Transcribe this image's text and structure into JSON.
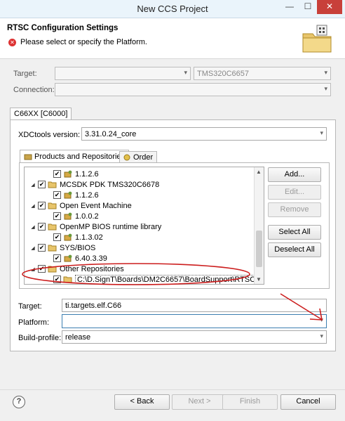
{
  "window": {
    "title": "New CCS Project",
    "min": "—",
    "max": "☐",
    "close": "✕"
  },
  "header": {
    "title": "RTSC Configuration Settings",
    "error": "Please select or specify the Platform."
  },
  "target_row": {
    "label": "Target:",
    "value": "",
    "device": "TMS320C6657"
  },
  "connection_row": {
    "label": "Connection:",
    "value": ""
  },
  "outer_tab": {
    "label": "C66XX [C6000]"
  },
  "xdctools": {
    "label": "XDCtools version:",
    "value": "3.31.0.24_core"
  },
  "inner_tabs": [
    {
      "label": "Products and Repositories"
    },
    {
      "label": "Order"
    }
  ],
  "tree": [
    {
      "indent": 1,
      "expander": "",
      "checked": true,
      "icon": "package",
      "label": "1.1.2.6"
    },
    {
      "indent": 0,
      "expander": "◢",
      "checked": true,
      "icon": "folder",
      "label": "MCSDK PDK TMS320C6678"
    },
    {
      "indent": 1,
      "expander": "",
      "checked": true,
      "icon": "package",
      "label": "1.1.2.6"
    },
    {
      "indent": 0,
      "expander": "◢",
      "checked": true,
      "icon": "folder",
      "label": "Open Event Machine"
    },
    {
      "indent": 1,
      "expander": "",
      "checked": true,
      "icon": "package",
      "label": "1.0.0.2"
    },
    {
      "indent": 0,
      "expander": "◢",
      "checked": true,
      "icon": "folder",
      "label": "OpenMP BIOS runtime library"
    },
    {
      "indent": 1,
      "expander": "",
      "checked": true,
      "icon": "package",
      "label": "1.1.3.02"
    },
    {
      "indent": 0,
      "expander": "◢",
      "checked": true,
      "icon": "folder",
      "label": "SYS/BIOS"
    },
    {
      "indent": 1,
      "expander": "",
      "checked": true,
      "icon": "package",
      "label": "6.40.3.39"
    },
    {
      "indent": 0,
      "expander": "◢",
      "checked": true,
      "icon": "folder",
      "label": "Other Repositories"
    },
    {
      "indent": 1,
      "expander": "",
      "checked": true,
      "icon": "folder",
      "label": "C:\\D.SignT\\Boards\\DM2C6657\\BoardSupport\\RTSC"
    }
  ],
  "side_buttons": {
    "add": "Add...",
    "edit": "Edit...",
    "remove": "Remove",
    "select_all": "Select All",
    "deselect_all": "Deselect All"
  },
  "bottom_fields": {
    "target": {
      "label": "Target:",
      "value": "ti.targets.elf.C66"
    },
    "platform": {
      "label": "Platform:",
      "value": ""
    },
    "build_profile": {
      "label": "Build-profile:",
      "value": "release"
    }
  },
  "footer": {
    "help": "?",
    "back": "< Back",
    "next": "Next >",
    "finish": "Finish",
    "cancel": "Cancel"
  },
  "colors": {
    "annotation_red": "#cc1d1d",
    "error_red": "#d33333"
  },
  "icons": {
    "error": "error-icon",
    "help": "help-icon",
    "wizard": "wizard-banner-icon"
  }
}
